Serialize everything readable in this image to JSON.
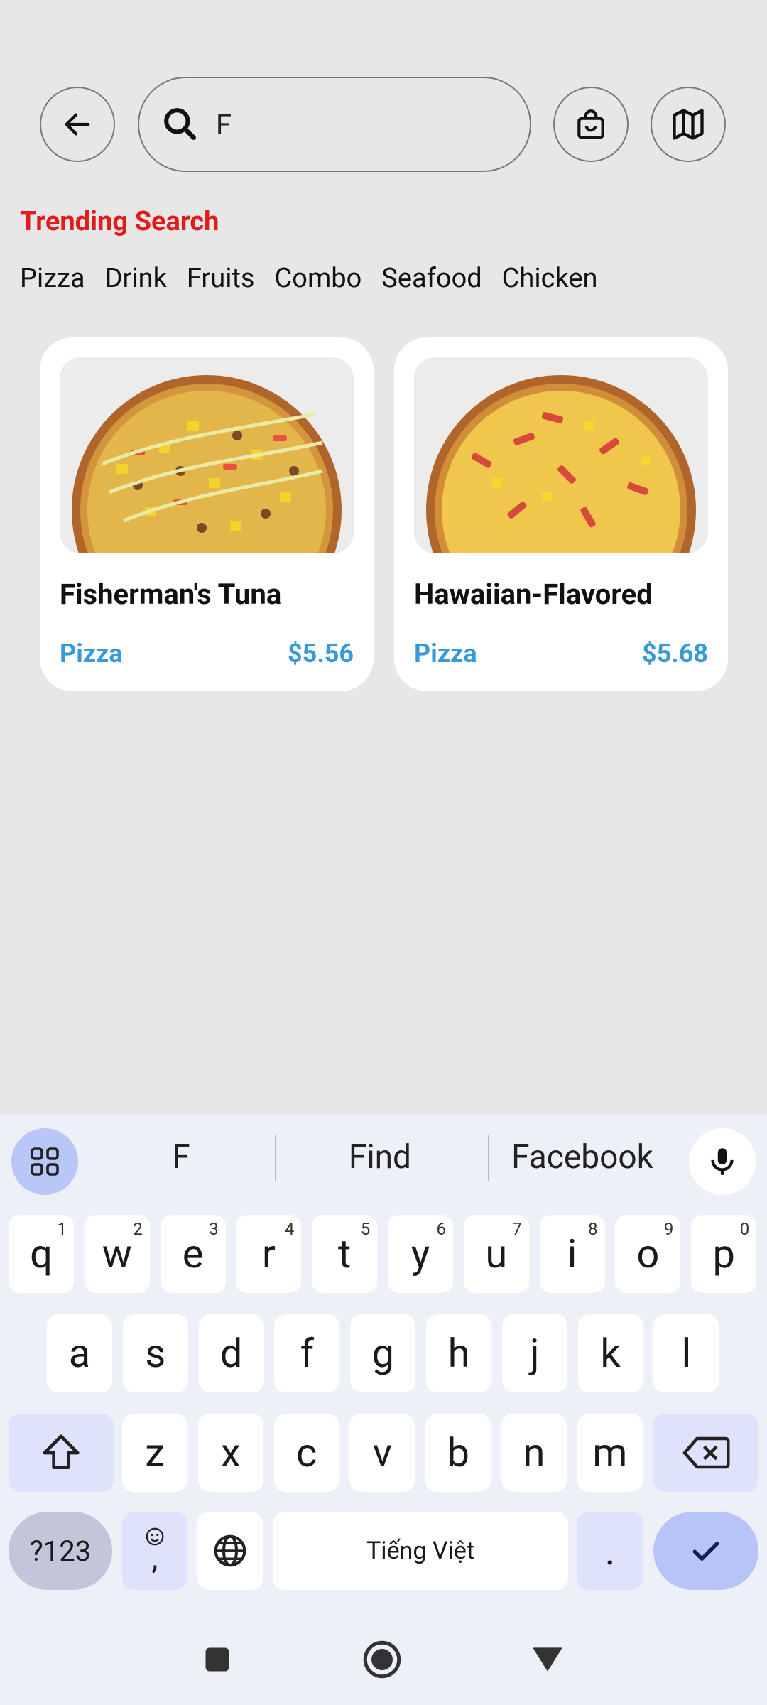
{
  "header": {
    "search_value": "F"
  },
  "trending": {
    "title": "Trending Search",
    "tags": [
      "Pizza",
      "Drink",
      "Fruits",
      "Combo",
      "Seafood",
      "Chicken"
    ]
  },
  "products": [
    {
      "name": "Fisherman's Tuna",
      "category": "Pizza",
      "price": "$5.56"
    },
    {
      "name": "Hawaiian-Flavored",
      "category": "Pizza",
      "price": "$5.68"
    }
  ],
  "keyboard": {
    "suggestions": [
      "F",
      "Find",
      "Facebook"
    ],
    "row1": [
      {
        "k": "q",
        "n": "1"
      },
      {
        "k": "w",
        "n": "2"
      },
      {
        "k": "e",
        "n": "3"
      },
      {
        "k": "r",
        "n": "4"
      },
      {
        "k": "t",
        "n": "5"
      },
      {
        "k": "y",
        "n": "6"
      },
      {
        "k": "u",
        "n": "7"
      },
      {
        "k": "i",
        "n": "8"
      },
      {
        "k": "o",
        "n": "9"
      },
      {
        "k": "p",
        "n": "0"
      }
    ],
    "row2": [
      "a",
      "s",
      "d",
      "f",
      "g",
      "h",
      "j",
      "k",
      "l"
    ],
    "row3": [
      "z",
      "x",
      "c",
      "v",
      "b",
      "n",
      "m"
    ],
    "sym_label": "?123",
    "emoji_comma": ",",
    "space_label": "Tiếng Việt",
    "period": "."
  },
  "colors": {
    "accent_red": "#e21b1b",
    "accent_blue": "#3a9ad9"
  }
}
